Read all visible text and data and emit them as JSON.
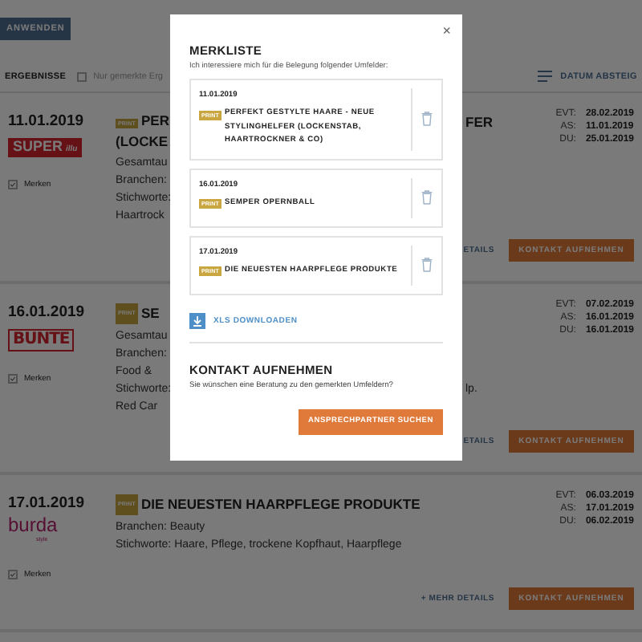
{
  "toolbar": {
    "apply_button": "ANWENDEN"
  },
  "results_bar": {
    "count_label": "ERGEBNISSE",
    "only_saved": {
      "label": "Nur gemerkte Erg",
      "checked": false
    },
    "sort": "DATUM ABSTEIG"
  },
  "results": [
    {
      "date": "11.01.2019",
      "logo": {
        "kind": "super_illu",
        "text": "SUPER",
        "sub": "illu"
      },
      "save": {
        "label": "Merken",
        "checked": true
      },
      "badge": "PRINT",
      "lines": [
        {
          "kind": "title",
          "text": "PER",
          "text_after_modal": "FER"
        },
        {
          "kind": "title",
          "text": "(LOCKE"
        },
        {
          "kind": "info",
          "text": "Gesamtau"
        },
        {
          "kind": "info",
          "text": "Branchen:"
        },
        {
          "kind": "info",
          "text": "Stichworte:"
        },
        {
          "kind": "info",
          "text": "Haartrock"
        }
      ],
      "meta": [
        {
          "label": "EVT:",
          "value": "28.02.2019"
        },
        {
          "label": "AS:",
          "value": "11.01.2019"
        },
        {
          "label": "DU:",
          "value": "25.01.2019"
        }
      ],
      "details_link": "ETAILS",
      "contact_button": "KONTAKT AUFNEHMEN"
    },
    {
      "date": "16.01.2019",
      "logo": {
        "kind": "bunte",
        "text": "BUNTE"
      },
      "save": {
        "label": "Merken",
        "checked": true
      },
      "badge": "PRINT",
      "lines": [
        {
          "kind": "title",
          "text": "SE"
        },
        {
          "kind": "info",
          "text": "Gesamtau"
        },
        {
          "kind": "info",
          "text": "Branchen:"
        },
        {
          "kind": "info",
          "text": "Food &"
        },
        {
          "kind": "info",
          "text": "Stichworte:",
          "text_after_modal": "lp."
        },
        {
          "kind": "info",
          "text": "Red Car"
        }
      ],
      "meta": [
        {
          "label": "EVT:",
          "value": "07.02.2019"
        },
        {
          "label": "AS:",
          "value": "16.01.2019"
        },
        {
          "label": "DU:",
          "value": "16.01.2019"
        }
      ],
      "details_link": "ETAILS",
      "contact_button": "KONTAKT AUFNEHMEN"
    },
    {
      "date": "17.01.2019",
      "logo": {
        "kind": "burda",
        "text": "burda",
        "sub": "style"
      },
      "save": {
        "label": "Merken",
        "checked": true
      },
      "badge": "PRINT",
      "lines": [
        {
          "kind": "title",
          "text": "DIE NEUESTEN HAARPFLEGE PRODUKTE"
        },
        {
          "kind": "info",
          "text": "Branchen: Beauty"
        },
        {
          "kind": "info",
          "text": "Stichworte: Haare, Pflege, trockene Kopfhaut, Haarpflege"
        }
      ],
      "meta": [
        {
          "label": "EVT:",
          "value": "06.03.2019"
        },
        {
          "label": "AS:",
          "value": "17.01.2019"
        },
        {
          "label": "DU:",
          "value": "06.02.2019"
        }
      ],
      "details_link": "+ MEHR DETAILS",
      "contact_button": "KONTAKT AUFNEHMEN"
    }
  ],
  "modal": {
    "close": "×",
    "title": "MERKLISTE",
    "subtitle": "Ich interessiere mich für die Belegung folgender Umfelder:",
    "items": [
      {
        "date": "11.01.2019",
        "badge": "PRINT",
        "title": "PERFEKT GESTYLTE HAARE - NEUE STYLINGHELFER (LOCKENSTAB, HAARTROCKNER & CO)"
      },
      {
        "date": "16.01.2019",
        "badge": "PRINT",
        "title": "SEMPER OPERNBALL"
      },
      {
        "date": "17.01.2019",
        "badge": "PRINT",
        "title": "DIE NEUESTEN HAARPFLEGE PRODUKTE"
      }
    ],
    "download": "XLS DOWNLOADEN",
    "contact_title": "KONTAKT AUFNEHMEN",
    "contact_text": "Sie wünschen eine Beratung zu den gemerkten Umfeldern?",
    "contact_button": "ANSPRECHPARTNER SUCHEN"
  }
}
